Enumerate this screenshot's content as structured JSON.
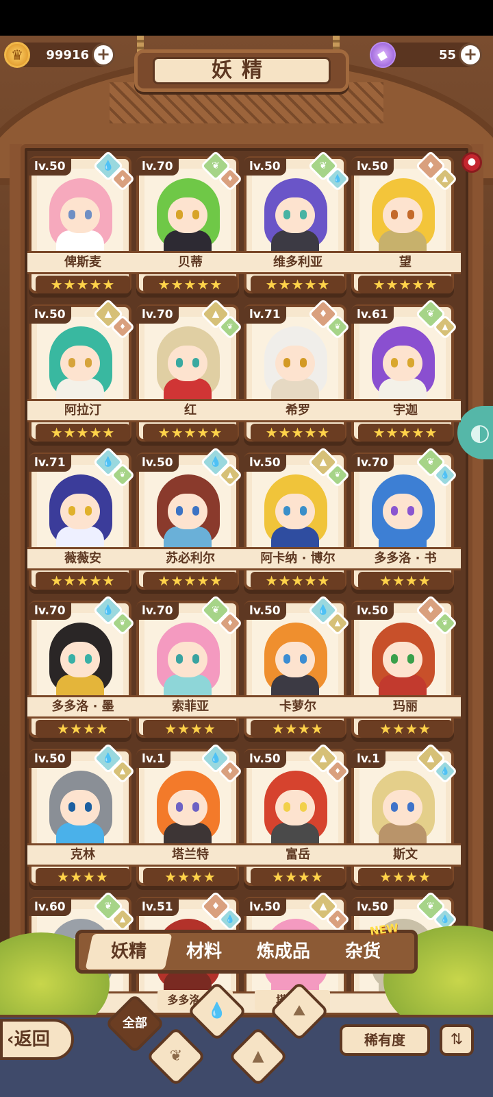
{
  "currency": {
    "gold": "99916",
    "gems": "55"
  },
  "header": {
    "title": "妖精"
  },
  "cards": [
    {
      "level": "lv.50",
      "name": "俾斯麦",
      "stars": "★★★★★",
      "elements": [
        "water",
        "fire"
      ],
      "hair": "#f6a9bd",
      "eye": "#6f8fc4",
      "outfit": "#ffffff"
    },
    {
      "level": "lv.70",
      "name": "贝蒂",
      "stars": "★★★★★",
      "elements": [
        "leaf",
        "fire"
      ],
      "hair": "#6fc847",
      "eye": "#d7a429",
      "outfit": "#2d2a33"
    },
    {
      "level": "lv.50",
      "name": "维多利亚",
      "stars": "★★★★★",
      "elements": [
        "leaf",
        "water"
      ],
      "hair": "#6a55c8",
      "eye": "#47b3a3",
      "outfit": "#3c3a44"
    },
    {
      "level": "lv.50",
      "name": "望",
      "stars": "★★★★★",
      "elements": [
        "fire",
        "earth"
      ],
      "hair": "#f3c53a",
      "eye": "#c46a2a",
      "outfit": "#c7b16c"
    },
    {
      "level": "lv.50",
      "name": "阿拉汀",
      "stars": "★★★★★",
      "elements": [
        "earth",
        "fire"
      ],
      "hair": "#39b8a0",
      "eye": "#d6a43b",
      "outfit": "#f4f1e8"
    },
    {
      "level": "lv.70",
      "name": "红",
      "stars": "★★★★★",
      "elements": [
        "earth",
        "leaf"
      ],
      "hair": "#e0cfa3",
      "eye": "#39a9a0",
      "outfit": "#d03535"
    },
    {
      "level": "lv.71",
      "name": "希罗",
      "stars": "★★★★★",
      "elements": [
        "fire",
        "leaf"
      ],
      "hair": "#f0eeea",
      "eye": "#d39a24",
      "outfit": "#e6d9c3"
    },
    {
      "level": "lv.61",
      "name": "宇迦",
      "stars": "★★★★★",
      "elements": [
        "leaf",
        "earth"
      ],
      "hair": "#8a4fd0",
      "eye": "#d9a72e",
      "outfit": "#f4f1e8"
    },
    {
      "level": "lv.71",
      "name": "薇薇安",
      "stars": "★★★★★",
      "elements": [
        "water",
        "leaf"
      ],
      "hair": "#3b3c9a",
      "eye": "#e0b12c",
      "outfit": "#eef0ff"
    },
    {
      "level": "lv.50",
      "name": "苏必利尔",
      "stars": "★★★★★",
      "elements": [
        "water",
        "earth"
      ],
      "hair": "#8a3a2c",
      "eye": "#3c73c4",
      "outfit": "#6ab0d8"
    },
    {
      "level": "lv.50",
      "name": "阿卡纳 · 博尔",
      "stars": "★★★★★",
      "elements": [
        "earth",
        "leaf"
      ],
      "hair": "#f0c43a",
      "eye": "#3a8fc9",
      "outfit": "#2f4da0"
    },
    {
      "level": "lv.70",
      "name": "多多洛 · 书",
      "stars": "★★★★",
      "elements": [
        "leaf",
        "water"
      ],
      "hair": "#3d7fd4",
      "eye": "#8a55d0",
      "outfit": "#3d7fd4"
    },
    {
      "level": "lv.70",
      "name": "多多洛 · 墨",
      "stars": "★★★★",
      "elements": [
        "water",
        "leaf"
      ],
      "hair": "#2a2626",
      "eye": "#3ab0a6",
      "outfit": "#e4b53a"
    },
    {
      "level": "lv.70",
      "name": "索菲亚",
      "stars": "★★★★",
      "elements": [
        "leaf",
        "fire"
      ],
      "hair": "#f49ac0",
      "eye": "#3aa3a0",
      "outfit": "#8ed6d8"
    },
    {
      "level": "lv.50",
      "name": "卡萝尔",
      "stars": "★★★★",
      "elements": [
        "water",
        "earth"
      ],
      "hair": "#ef8f2e",
      "eye": "#3c8dd2",
      "outfit": "#3c3a44"
    },
    {
      "level": "lv.50",
      "name": "玛丽",
      "stars": "★★★★",
      "elements": [
        "fire",
        "leaf"
      ],
      "hair": "#c8502a",
      "eye": "#3aa04b",
      "outfit": "#c23a2e"
    },
    {
      "level": "lv.50",
      "name": "克林",
      "stars": "★★★★",
      "elements": [
        "water",
        "earth"
      ],
      "hair": "#8a8f96",
      "eye": "#1c5fa0",
      "outfit": "#4ab1ea"
    },
    {
      "level": "lv.1",
      "name": "塔兰特",
      "stars": "★★★★",
      "elements": [
        "water",
        "fire"
      ],
      "hair": "#f37a2a",
      "eye": "#6e62c4",
      "outfit": "#3d3535"
    },
    {
      "level": "lv.50",
      "name": "富岳",
      "stars": "★★★★",
      "elements": [
        "earth",
        "fire"
      ],
      "hair": "#d6432e",
      "eye": "#f2d04a",
      "outfit": "#4a4a4a"
    },
    {
      "level": "lv.1",
      "name": "斯文",
      "stars": "★★★★",
      "elements": [
        "earth",
        "water"
      ],
      "hair": "#e4cf8a",
      "eye": "#3f73c9",
      "outfit": "#b9946a"
    },
    {
      "level": "lv.60",
      "name": "",
      "stars": "",
      "elements": [
        "leaf",
        "earth"
      ],
      "hair": "#9aa0a8",
      "eye": "#3f73c9",
      "outfit": "#9aa0a8"
    },
    {
      "level": "lv.51",
      "name": "",
      "stars": "",
      "elements": [
        "fire",
        "water"
      ],
      "hair": "#b3322a",
      "eye": "#3f73c9",
      "outfit": "#7a2a22"
    },
    {
      "level": "lv.50",
      "name": "",
      "stars": "",
      "elements": [
        "earth",
        "fire"
      ],
      "hair": "#f49ac0",
      "eye": "#3f73c9",
      "outfit": "#f49ac0"
    },
    {
      "level": "lv.50",
      "name": "",
      "stars": "",
      "elements": [
        "leaf",
        "water"
      ],
      "hair": "#c9c0a8",
      "eye": "#3f73c9",
      "outfit": "#c9c0a8"
    }
  ],
  "tabs": [
    {
      "label": "妖精",
      "active": true
    },
    {
      "label": "材料",
      "active": false
    },
    {
      "label": "炼成品",
      "active": false
    },
    {
      "label": "杂货",
      "active": false
    }
  ],
  "new_badge": "NEW",
  "bottom": {
    "back_label": "返回",
    "filter_all_label": "全部",
    "filters": [
      "water-filter-icon",
      "leaf-filter-icon",
      "earth-filter-icon",
      "mountain-filter-icon"
    ],
    "rarity_label": "稀有度",
    "sort_icon": "sort-icon"
  },
  "peek_names": [
    "多多洛 · 田",
    "塔利亚"
  ]
}
